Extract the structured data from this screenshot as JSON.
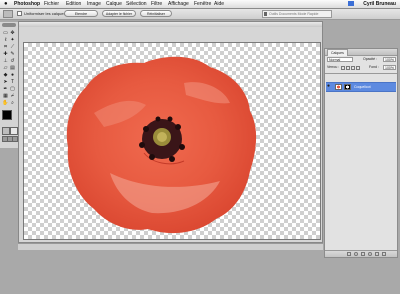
{
  "menubar": {
    "app_name": "Photoshop",
    "items": [
      "Fichier",
      "Edition",
      "Image",
      "Calque",
      "Sélection",
      "Filtre",
      "Affichage",
      "Fenêtre",
      "Aide"
    ],
    "user": "Cyril Bruneau"
  },
  "options": {
    "checkbox_label": "Uniformiser les calques",
    "buttons": [
      "Etendre",
      "Adapter le fichier",
      "Réinitialiser"
    ],
    "well_text": "Outils Documents Mode Rapide"
  },
  "layers": {
    "tab_label": "Calques",
    "mode": "Normal",
    "opacity_label": "Opacité :",
    "opacity_value": "100%",
    "lock_label": "Verrou :",
    "fill_label": "Fond :",
    "fill_value": "100%",
    "layer_name": "Coquelicot"
  },
  "colors": {
    "accent": "#5d8ae0",
    "petal": "#e5573f",
    "petal_light": "#f59a87"
  }
}
